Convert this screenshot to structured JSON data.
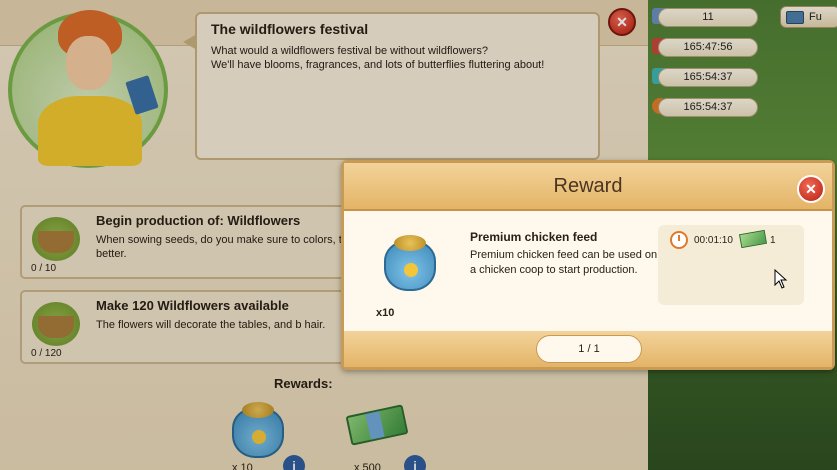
{
  "hud": {
    "stats": [
      "11",
      "165:47:56",
      "165:54:37",
      "165:54:37"
    ],
    "fu_label": "Fu"
  },
  "quest": {
    "title": "The wildflowers festival",
    "description": "What would a wildflowers festival be without wildflowers?\nWe'll have blooms, fragrances, and lots of butterflies fluttering about!",
    "tasks": [
      {
        "title": "Begin production of: Wildflowers",
        "desc": "When sowing seeds, do you make sure to colors, the better.",
        "count": "0 / 10"
      },
      {
        "title": "Make 120 Wildflowers available",
        "desc": "The flowers will decorate the tables, and b hair.",
        "count": "0 / 120"
      }
    ],
    "rewards_label": "Rewards:",
    "rewards": [
      "x 10",
      "x 500"
    ]
  },
  "modal": {
    "title": "Reward",
    "item_name": "Premium chicken feed",
    "item_desc": "Premium chicken feed can be used on a chicken coop to start production.",
    "item_qty": "x10",
    "stat_time": "00:01:10",
    "stat_cost": "1",
    "pager": "1 / 1"
  },
  "icons": {
    "close": "close-icon",
    "clock": "clock-icon",
    "cash": "cash-icon",
    "feed": "chicken-feed-sack-icon",
    "info": "info-icon"
  }
}
